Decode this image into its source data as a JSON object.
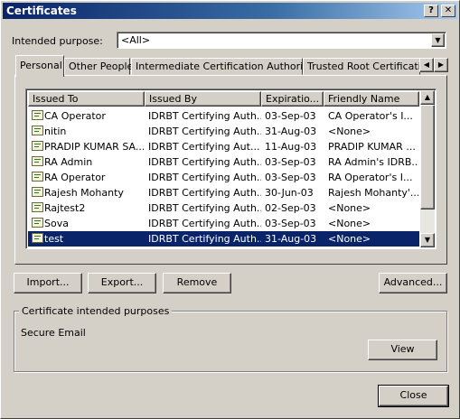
{
  "window": {
    "title": "Certificates",
    "help_button": "?",
    "close_button": "✕"
  },
  "purpose": {
    "label": "Intended purpose:",
    "value": "<All>"
  },
  "tabs": [
    {
      "label": "Personal"
    },
    {
      "label": "Other People"
    },
    {
      "label": "Intermediate Certification Authorities"
    },
    {
      "label": "Trusted Root Certification"
    }
  ],
  "list": {
    "columns": [
      "Issued To",
      "Issued By",
      "Expiratio...",
      "Friendly Name"
    ],
    "rows": [
      {
        "issued_to": "CA Operator",
        "issued_by": "IDRBT Certifying Auth...",
        "expiration": "03-Sep-03",
        "friendly": "CA Operator's I..."
      },
      {
        "issued_to": "nitin",
        "issued_by": "IDRBT Certifying Auth...",
        "expiration": "31-Aug-03",
        "friendly": "<None>"
      },
      {
        "issued_to": "PRADIP KUMAR SA...",
        "issued_by": "IDRBT Certifying  Aut...",
        "expiration": "11-Aug-03",
        "friendly": "PRADIP KUMAR ..."
      },
      {
        "issued_to": "RA Admin",
        "issued_by": "IDRBT Certifying Auth...",
        "expiration": "03-Sep-03",
        "friendly": "RA Admin's IDRB..."
      },
      {
        "issued_to": "RA Operator",
        "issued_by": "IDRBT Certifying Auth...",
        "expiration": "03-Sep-03",
        "friendly": "RA Operator's I..."
      },
      {
        "issued_to": "Rajesh Mohanty",
        "issued_by": "IDRBT Certifying Auth...",
        "expiration": "30-Jun-03",
        "friendly": "Rajesh Mohanty'..."
      },
      {
        "issued_to": "Rajtest2",
        "issued_by": "IDRBT Certifying Auth...",
        "expiration": "02-Sep-03",
        "friendly": "<None>"
      },
      {
        "issued_to": "Sova",
        "issued_by": "IDRBT Certifying Auth...",
        "expiration": "03-Sep-03",
        "friendly": "<None>"
      },
      {
        "issued_to": "test",
        "issued_by": "IDRBT Certifying Auth...",
        "expiration": "31-Aug-03",
        "friendly": "<None>"
      }
    ]
  },
  "buttons": {
    "import": "Import...",
    "export": "Export...",
    "remove": "Remove",
    "advanced": "Advanced...",
    "view": "View",
    "close": "Close"
  },
  "purposes_group": {
    "title": "Certificate intended purposes",
    "value": "Secure Email"
  },
  "colors": {
    "title_bar": "#0a246a",
    "selection": "#0a246a",
    "face": "#d4d0c8"
  }
}
